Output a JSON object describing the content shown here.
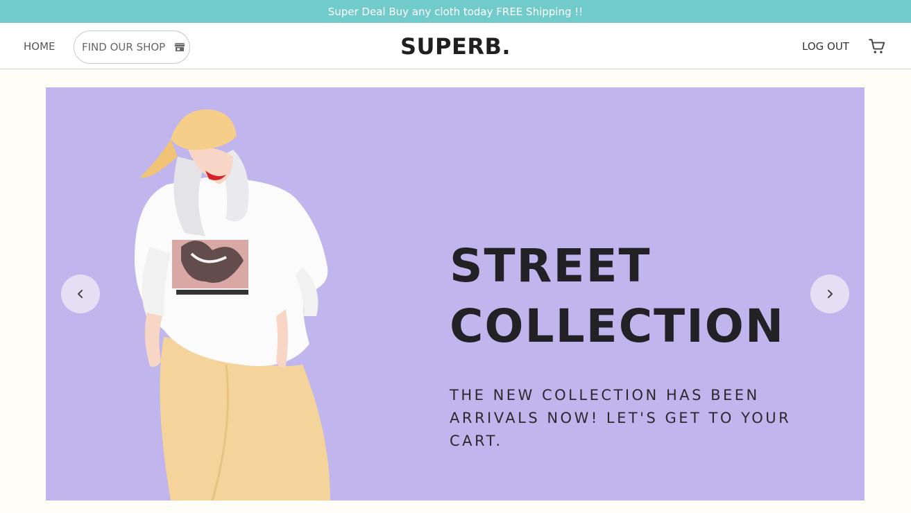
{
  "promo": {
    "text": "Super Deal Buy any cloth today FREE Shipping !!"
  },
  "nav": {
    "home_label": "HOME",
    "shop_label": "FIND OUR SHOP",
    "shop_icon": "store-icon",
    "logo_text": "SUPERB.",
    "logout_label": "LOG OUT",
    "cart_icon": "cart-icon"
  },
  "hero": {
    "title_line1": "STREET",
    "title_line2": "COLLECTION",
    "subtitle_line1": "THE NEW COLLECTION HAS BEEN",
    "subtitle_line2": "ARRIVALS NOW! LET'S GET TO YOUR",
    "subtitle_line3": "CART.",
    "prev_icon": "chevron-left-icon",
    "next_icon": "chevron-right-icon"
  },
  "colors": {
    "promo_bg": "#72cbcb",
    "hero_bg": "#c0b5ec",
    "text_dark": "#222226"
  }
}
